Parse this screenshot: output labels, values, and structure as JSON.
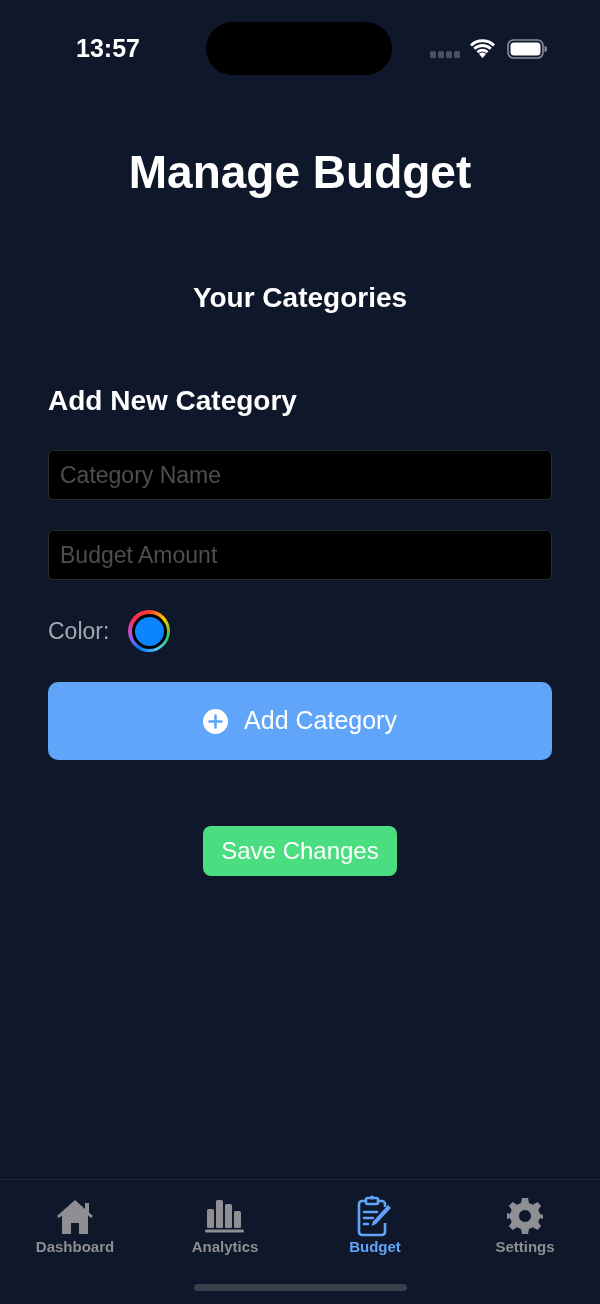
{
  "status_bar": {
    "time": "13:57"
  },
  "title": "Manage Budget",
  "section_title": "Your Categories",
  "form": {
    "heading": "Add New Category",
    "fields": [
      {
        "placeholder": "Category Name"
      },
      {
        "placeholder": "Budget Amount"
      }
    ],
    "color_label": "Color:",
    "color": "#0a84ff",
    "add_button": "Add Category"
  },
  "save_button": "Save Changes",
  "tab_bar": [
    {
      "label": "Dashboard",
      "kind": "home",
      "selected": false
    },
    {
      "label": "Analytics",
      "kind": "chart",
      "selected": false
    },
    {
      "label": "Budget",
      "kind": "clipboard",
      "selected": true
    },
    {
      "label": "Settings",
      "kind": "gear",
      "selected": false
    }
  ]
}
